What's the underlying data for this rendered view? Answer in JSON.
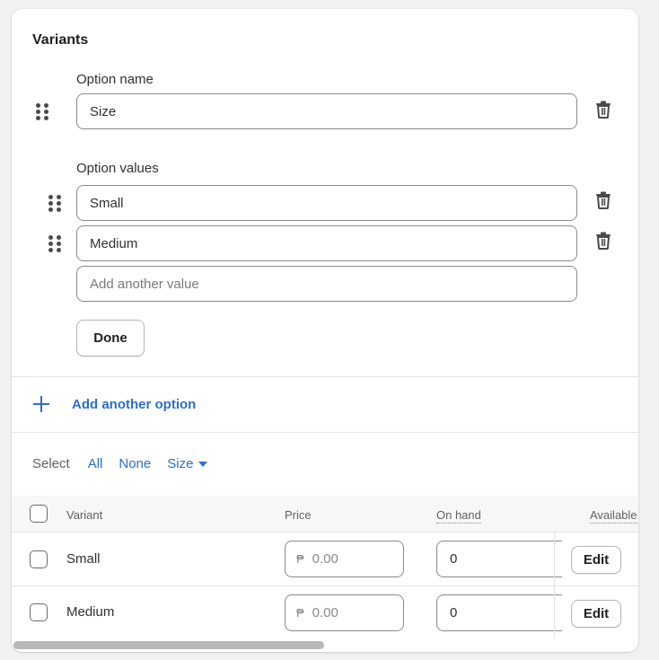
{
  "card": {
    "title": "Variants",
    "option_name_label": "Option name",
    "option_name_value": "Size",
    "option_values_label": "Option values",
    "option_values": [
      "Small",
      "Medium"
    ],
    "add_value_placeholder": "Add another value",
    "done_label": "Done",
    "add_option_label": "Add another option"
  },
  "select_bar": {
    "label": "Select",
    "all": "All",
    "none": "None",
    "size": "Size"
  },
  "table": {
    "headers": {
      "variant": "Variant",
      "price": "Price",
      "on_hand": "On hand",
      "available": "Available"
    },
    "currency_symbol": "₱",
    "rows": [
      {
        "name": "Small",
        "price_placeholder": "0.00",
        "on_hand": "0",
        "edit_label": "Edit"
      },
      {
        "name": "Medium",
        "price_placeholder": "0.00",
        "on_hand": "0",
        "edit_label": "Edit"
      }
    ]
  },
  "colors": {
    "accent": "#2c6ecb",
    "text": "#303030",
    "border": "#8a8a8a"
  },
  "icons": [
    "drag-handle-icon",
    "trash-icon",
    "plus-icon",
    "caret-down-icon",
    "checkbox-icon"
  ]
}
